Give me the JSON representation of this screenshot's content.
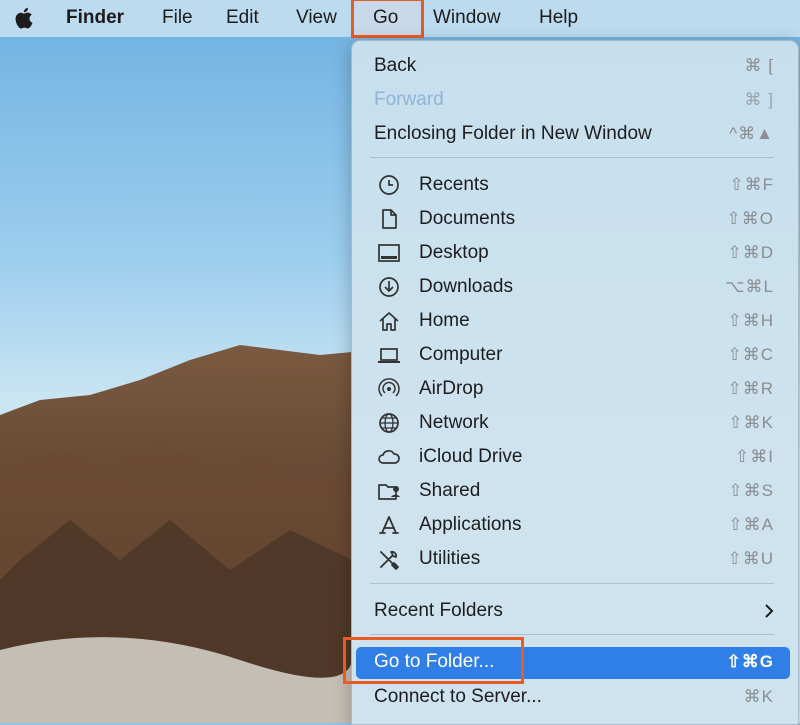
{
  "menubar": {
    "app": "Finder",
    "items": [
      "File",
      "Edit",
      "View",
      "Go",
      "Window",
      "Help"
    ]
  },
  "go_menu": {
    "top_items": [
      {
        "label": "Back",
        "shortcut": "⌘ ["
      },
      {
        "label": "Forward",
        "shortcut": "⌘ ]",
        "disabled": true
      },
      {
        "label": "Enclosing Folder in New Window",
        "shortcut": "^⌘▲"
      }
    ],
    "places": [
      {
        "label": "Recents",
        "shortcut": "⇧⌘F",
        "icon": "clock-icon"
      },
      {
        "label": "Documents",
        "shortcut": "⇧⌘O",
        "icon": "document-icon"
      },
      {
        "label": "Desktop",
        "shortcut": "⇧⌘D",
        "icon": "desktop-icon"
      },
      {
        "label": "Downloads",
        "shortcut": "⌥⌘L",
        "icon": "download-icon"
      },
      {
        "label": "Home",
        "shortcut": "⇧⌘H",
        "icon": "home-icon"
      },
      {
        "label": "Computer",
        "shortcut": "⇧⌘C",
        "icon": "laptop-icon"
      },
      {
        "label": "AirDrop",
        "shortcut": "⇧⌘R",
        "icon": "airdrop-icon"
      },
      {
        "label": "Network",
        "shortcut": "⇧⌘K",
        "icon": "globe-icon"
      },
      {
        "label": "iCloud Drive",
        "shortcut": "⇧⌘I",
        "icon": "cloud-icon"
      },
      {
        "label": "Shared",
        "shortcut": "⇧⌘S",
        "icon": "shared-folder-icon"
      },
      {
        "label": "Applications",
        "shortcut": "⇧⌘A",
        "icon": "applications-icon"
      },
      {
        "label": "Utilities",
        "shortcut": "⇧⌘U",
        "icon": "utilities-icon"
      }
    ],
    "recent_folders": {
      "label": "Recent Folders",
      "icon": "chevron-right-icon"
    },
    "go_to_folder": {
      "label": "Go to Folder...",
      "shortcut": "⇧⌘G",
      "selected": true
    },
    "connect_to_server": {
      "label": "Connect to Server...",
      "shortcut": "⌘K"
    }
  },
  "colors": {
    "highlight": "#2f7fe6",
    "callout": "#ea5a23"
  }
}
